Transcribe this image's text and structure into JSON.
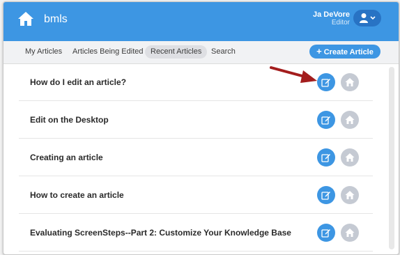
{
  "app": {
    "title": "bmls"
  },
  "user": {
    "name": "Ja DeVore",
    "role": "Editor"
  },
  "tabs": [
    {
      "label": "My Articles"
    },
    {
      "label": "Articles Being Edited"
    },
    {
      "label": "Recent Articles",
      "active": true
    },
    {
      "label": "Search"
    }
  ],
  "create_button": {
    "label": "Create Article"
  },
  "articles": [
    {
      "title": "How do I edit an article?"
    },
    {
      "title": "Edit on the Desktop"
    },
    {
      "title": "Creating an article"
    },
    {
      "title": "How to create an article"
    },
    {
      "title": "Evaluating ScreenSteps--Part 2: Customize Your Knowledge Base"
    }
  ],
  "icons": {
    "home": "home-icon",
    "user": "user-icon",
    "plus": "plus-icon",
    "edit": "edit-icon",
    "view": "home-icon",
    "annotation": "arrow-icon"
  },
  "colors": {
    "primary": "#3d96e3",
    "primary_dark": "#2873c4",
    "secondary": "#c5cad3",
    "annotation": "#a31d1d"
  }
}
